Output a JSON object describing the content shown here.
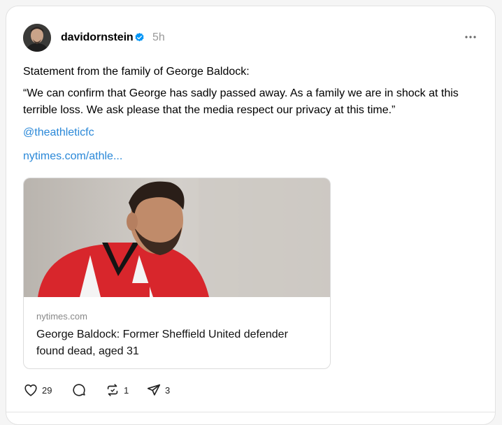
{
  "post": {
    "author": {
      "username": "davidornstein",
      "verified": true,
      "time_ago": "5h"
    },
    "paragraph_1": "Statement from the family of George Baldock:",
    "paragraph_2": "“We can confirm that George has sadly passed away. As a family we are in shock at this terrible loss. We ask please that the media respect our privacy at this time.”",
    "mention": "@theathleticfc",
    "link": "nytimes.com/athle...",
    "link_preview": {
      "source": "nytimes.com",
      "title": "George Baldock: Former Sheffield United defender found dead, aged 31"
    },
    "actions": {
      "likes": "29",
      "replies": "",
      "reposts": "1",
      "shares": "3"
    },
    "icons": [
      "verified-badge-icon",
      "more-icon",
      "heart-icon",
      "comment-icon",
      "repost-icon",
      "share-icon"
    ],
    "colors": {
      "link": "#2a88d8",
      "verified": "#0095f6",
      "muted": "#999999"
    }
  }
}
